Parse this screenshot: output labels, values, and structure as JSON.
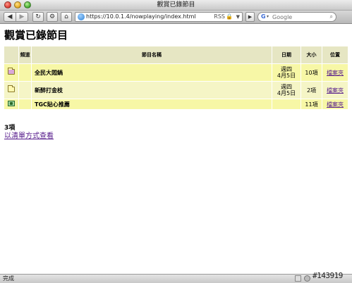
{
  "window": {
    "title": "觀賞已錄節目"
  },
  "toolbar": {
    "back_icon": "◀",
    "forward_icon": "▶",
    "reload_icon": "↻",
    "gear_icon": "⚙",
    "home_icon": "⌂",
    "snapback_icon": "▶",
    "rss_label": "RSS",
    "lock_icon": "🔒",
    "dropdown_icon": "▼"
  },
  "address": {
    "url": "https://10.0.1.4/nowplaying/index.html"
  },
  "search": {
    "engine_glyph": "G",
    "dropdown_icon": "▾",
    "placeholder": "Google",
    "search_icon": "⌕"
  },
  "page": {
    "title": "觀賞已錄節目",
    "table": {
      "headers": {
        "channel": "頻道",
        "name": "節目名稱",
        "date": "日期",
        "size": "大小",
        "location": "位置"
      },
      "rows": [
        {
          "icon": "folder-full-icon",
          "channel": "",
          "name": "全民大悶鍋",
          "date_line1": "週四",
          "date_line2": "4月5日",
          "size": "10項",
          "location": "檔案夾"
        },
        {
          "icon": "folder-icon",
          "channel": "",
          "name": "新醉打金枝",
          "date_line1": "週四",
          "date_line2": "4月5日",
          "size": "2項",
          "location": "檔案夾"
        },
        {
          "icon": "tv-icon",
          "channel": "",
          "name": "TGC貼心推薦",
          "date_line1": "",
          "date_line2": "",
          "size": "11項",
          "location": "檔案夾"
        }
      ]
    },
    "count_text": "3項",
    "list_view_link": "以清單方式查看"
  },
  "status": {
    "text": "完成"
  },
  "watermark": "#143919",
  "colors": {
    "header_bg": "#e6e6c3",
    "row_bg": "#f7f7a6",
    "row_alt_bg": "#f5f5c6",
    "link": "#551a8b"
  }
}
